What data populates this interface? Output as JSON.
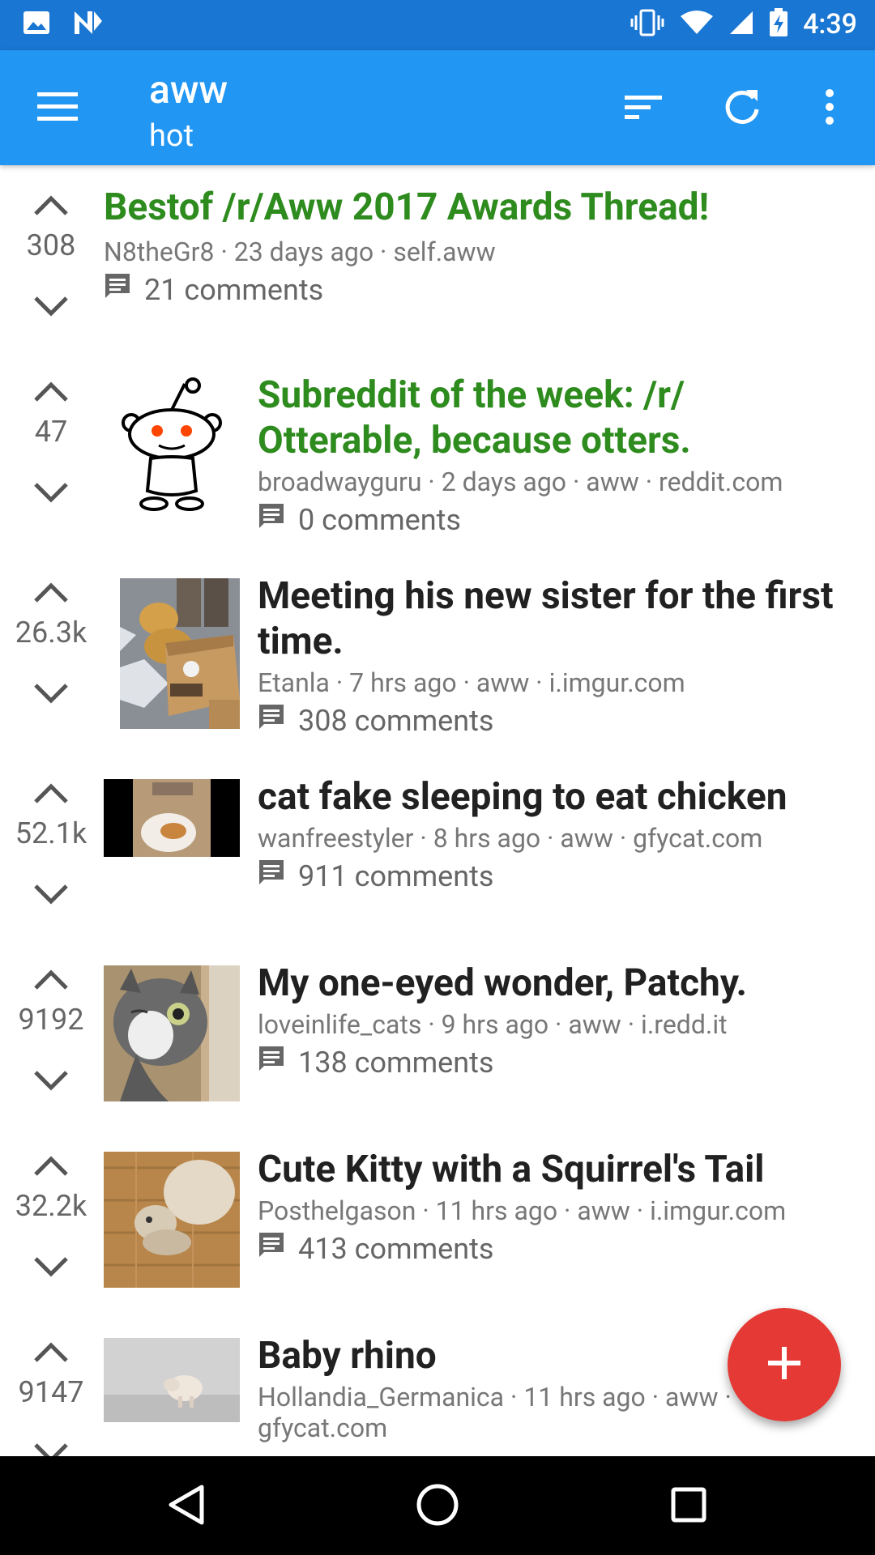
{
  "status_bar": {
    "time": "4:39",
    "icons": [
      "image-icon",
      "n-icon",
      "vibrate-icon",
      "wifi-icon",
      "signal-icon",
      "battery-charging-icon"
    ]
  },
  "app_bar": {
    "title": "aww",
    "subtitle": "hot",
    "icons": [
      "menu-icon",
      "sort-icon",
      "refresh-icon",
      "more-vert-icon"
    ]
  },
  "posts": [
    {
      "score": "308",
      "title": "Bestof /r/Aww 2017 Awards Thread!",
      "meta": "N8theGr8 · 23 days ago · self.aww",
      "comments": "21 comments",
      "stickied": true,
      "thumbnail": null
    },
    {
      "score": "47",
      "title": "Subreddit of the week: /r/ Otterable, because otters.",
      "meta": "broadwayguru · 2 days ago · aww · reddit.com",
      "comments": "0 comments",
      "stickied": true,
      "thumbnail": "reddit-alien"
    },
    {
      "score": "26.3k",
      "title": "Meeting his new sister for the first time.",
      "meta": "Etanla · 7 hrs ago · aww · i.imgur.com",
      "comments": "308 comments",
      "stickied": false,
      "thumbnail": "dog-and-kitten"
    },
    {
      "score": "52.1k",
      "title": "cat fake sleeping to eat chicken",
      "meta": "wanfreestyler · 8 hrs ago · aww · gfycat.com",
      "comments": "911 comments",
      "stickied": false,
      "thumbnail": "chicken-plate"
    },
    {
      "score": "9192",
      "title": "My one-eyed wonder, Patchy.",
      "meta": "loveinlife_cats · 9 hrs ago · aww · i.redd.it",
      "comments": "138 comments",
      "stickied": false,
      "thumbnail": "tabby-cat"
    },
    {
      "score": "32.2k",
      "title": "Cute Kitty with a Squirrel's Tail",
      "meta": "Posthelgason · 11 hrs ago · aww · i.imgur.com",
      "comments": "413 comments",
      "stickied": false,
      "thumbnail": "kitty-on-floor"
    },
    {
      "score": "9147",
      "title": "Baby rhino",
      "meta": "Hollandia_Germanica · 11 hrs ago · aww · gfycat.com",
      "comments": "",
      "stickied": false,
      "thumbnail": "baby-rhino"
    }
  ],
  "fab": {
    "icon": "add-icon"
  },
  "nav_bar": {
    "icons": [
      "back-icon",
      "home-icon",
      "recents-icon"
    ]
  },
  "colors": {
    "status_bar": "#1976D2",
    "app_bar": "#2196F3",
    "stickied_title": "#2E8B1E",
    "fab": "#E53935"
  }
}
